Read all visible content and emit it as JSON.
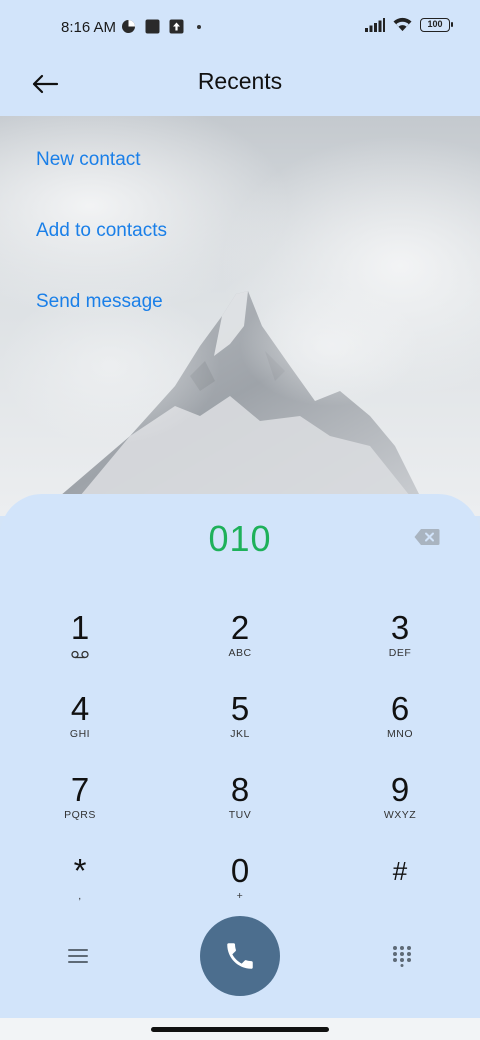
{
  "status_bar": {
    "time": "8:16 AM",
    "left_icons": [
      "data-saver-icon",
      "square-icon",
      "upload-icon",
      "dot-icon"
    ],
    "right_icons": [
      "signal-icon",
      "wifi-icon",
      "battery-icon"
    ],
    "battery_level": "100"
  },
  "header": {
    "title": "Recents",
    "back_icon": "arrow-left-icon"
  },
  "actions": {
    "new_contact": "New contact",
    "add_to_contacts": "Add to contacts",
    "send_message": "Send message"
  },
  "dialer": {
    "number": "010",
    "number_color": "#1eb15a",
    "backspace_icon": "backspace-icon",
    "keys": [
      {
        "digit": "1",
        "letters": ""
      },
      {
        "digit": "2",
        "letters": "ABC"
      },
      {
        "digit": "3",
        "letters": "DEF"
      },
      {
        "digit": "4",
        "letters": "GHI"
      },
      {
        "digit": "5",
        "letters": "JKL"
      },
      {
        "digit": "6",
        "letters": "MNO"
      },
      {
        "digit": "7",
        "letters": "PQRS"
      },
      {
        "digit": "8",
        "letters": "TUV"
      },
      {
        "digit": "9",
        "letters": "WXYZ"
      },
      {
        "digit": "*",
        "letters": ","
      },
      {
        "digit": "0",
        "letters": "+"
      },
      {
        "digit": "#",
        "letters": ""
      }
    ],
    "menu_icon": "menu-icon",
    "call_icon": "phone-icon",
    "call_button_color": "#4c6e8e",
    "dialpad_icon": "dialpad-icon"
  },
  "colors": {
    "accent_link": "#1a7fe8",
    "panel_background": "#d2e4fa"
  }
}
